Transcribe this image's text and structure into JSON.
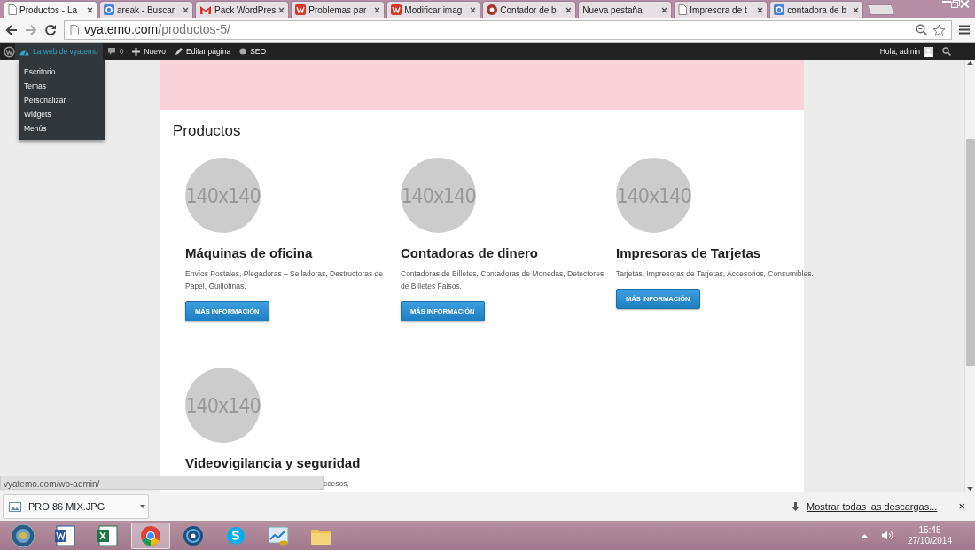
{
  "tabs": [
    {
      "title": "Productos - La",
      "kind": "page",
      "selected": true
    },
    {
      "title": "areak - Buscar",
      "kind": "google",
      "selected": false
    },
    {
      "title": "Pack WordPres",
      "kind": "gmail",
      "selected": false
    },
    {
      "title": "Problemas par",
      "kind": "w",
      "selected": false
    },
    {
      "title": "Modificar imag",
      "kind": "w",
      "selected": false
    },
    {
      "title": "Contador de b",
      "kind": "badge",
      "selected": false
    },
    {
      "title": "Nueva pestaña",
      "kind": "none",
      "selected": false
    },
    {
      "title": "Impresora de t",
      "kind": "page",
      "selected": false
    },
    {
      "title": "contadora de b",
      "kind": "google",
      "selected": false
    }
  ],
  "address": {
    "host": "vyatemo.com",
    "path": "/productos-5/"
  },
  "admin_bar": {
    "site": "La web de vyatemo",
    "comments": "0",
    "new": "Nuevo",
    "edit": "Editar página",
    "seo": "SEO",
    "greeting": "Hola, admin"
  },
  "site_menu": [
    "Escritorio",
    "Temas",
    "Personalizar",
    "Widgets",
    "Menús"
  ],
  "page": {
    "heading": "Productos",
    "products": [
      {
        "image": "140x140",
        "title": "Máquinas de oficina",
        "description": "Envíos Postales, Plegadoras – Selladoras, Destructoras de Papel, Guillotinas.",
        "button": "MÁS INFORMACIÓN"
      },
      {
        "image": "140x140",
        "title": "Contadoras de dinero",
        "description": "Contadoras de Billetes, Contadoras de Monedas, Detectores de Billetes Falsos.",
        "button": "MÁS INFORMACIÓN"
      },
      {
        "image": "140x140",
        "title": "Impresoras de Tarjetas",
        "description": "Tarjetas, Impresoras de Tarjetas, Accesorios, Consumibles.",
        "button": "MÁS INFORMACIÓN"
      },
      {
        "image": "140x140",
        "title": "Videovigilancia y seguridad",
        "description": "ccesos,",
        "covered": true
      }
    ]
  },
  "status_url": "vyatemo.com/wp-admin/",
  "downloads": {
    "file": "PRO 86 MIX.JPG",
    "show_all": "Mostrar todas las descargas...",
    "close": "×"
  },
  "taskbar": {
    "apps": [
      {
        "kind": "word",
        "selected": false
      },
      {
        "kind": "excel",
        "selected": false
      },
      {
        "kind": "chrome",
        "selected": true
      },
      {
        "kind": "disc",
        "selected": false
      },
      {
        "kind": "skype",
        "selected": false
      },
      {
        "kind": "chart",
        "selected": false
      },
      {
        "kind": "folder",
        "selected": false
      }
    ],
    "time": "15:45",
    "date": "27/10/2014"
  }
}
